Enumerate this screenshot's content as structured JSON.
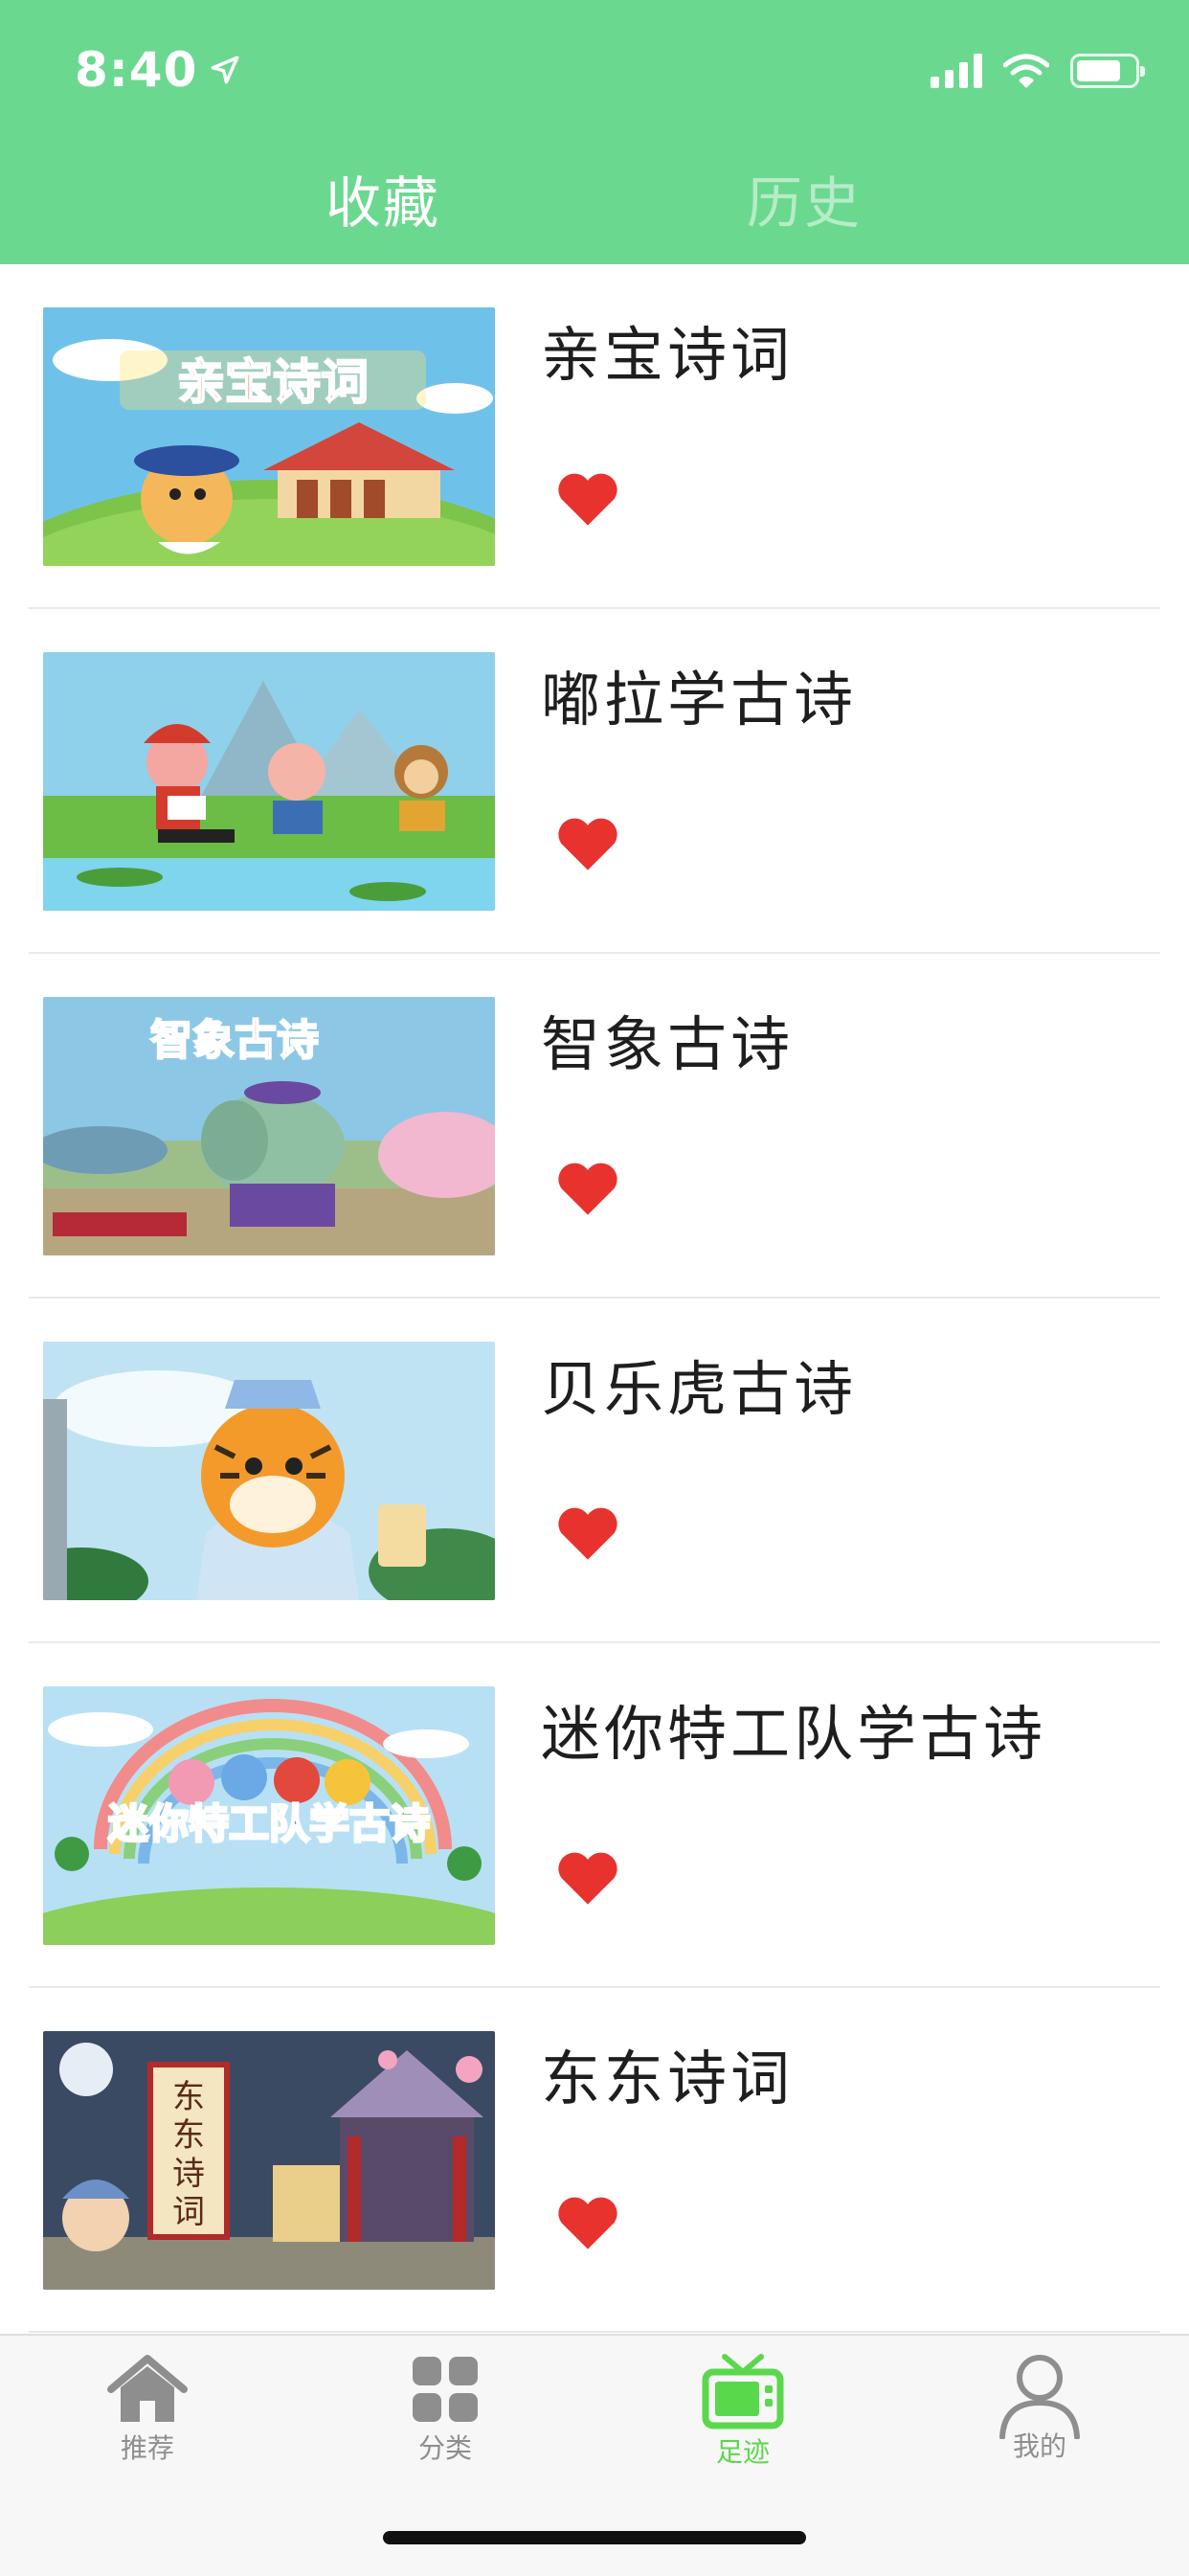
{
  "status_bar": {
    "time": "8:40",
    "battery_level": 0.78
  },
  "top_tabs": {
    "favorites": "收藏",
    "history": "历史",
    "active": "favorites"
  },
  "list": [
    {
      "title": "亲宝诗词",
      "favorited": true,
      "thumb_caption": "亲宝诗词"
    },
    {
      "title": "嘟拉学古诗",
      "favorited": true,
      "thumb_caption": ""
    },
    {
      "title": "智象古诗",
      "favorited": true,
      "thumb_caption": "智象古诗"
    },
    {
      "title": "贝乐虎古诗",
      "favorited": true,
      "thumb_caption": ""
    },
    {
      "title": "迷你特工队学古诗",
      "favorited": true,
      "thumb_caption": "迷你特工队学古诗"
    },
    {
      "title": "东东诗词",
      "favorited": true,
      "thumb_caption": "东东诗词"
    }
  ],
  "tabbar": {
    "items": [
      {
        "label": "推荐",
        "icon": "home-icon"
      },
      {
        "label": "分类",
        "icon": "grid-icon"
      },
      {
        "label": "足迹",
        "icon": "tv-icon"
      },
      {
        "label": "我的",
        "icon": "person-icon"
      }
    ],
    "active_index": 2
  },
  "colors": {
    "header": "#6bd890",
    "heart": "#e8322e",
    "tab_active": "#5ad84c",
    "tab_inactive": "#8e8e8e"
  }
}
